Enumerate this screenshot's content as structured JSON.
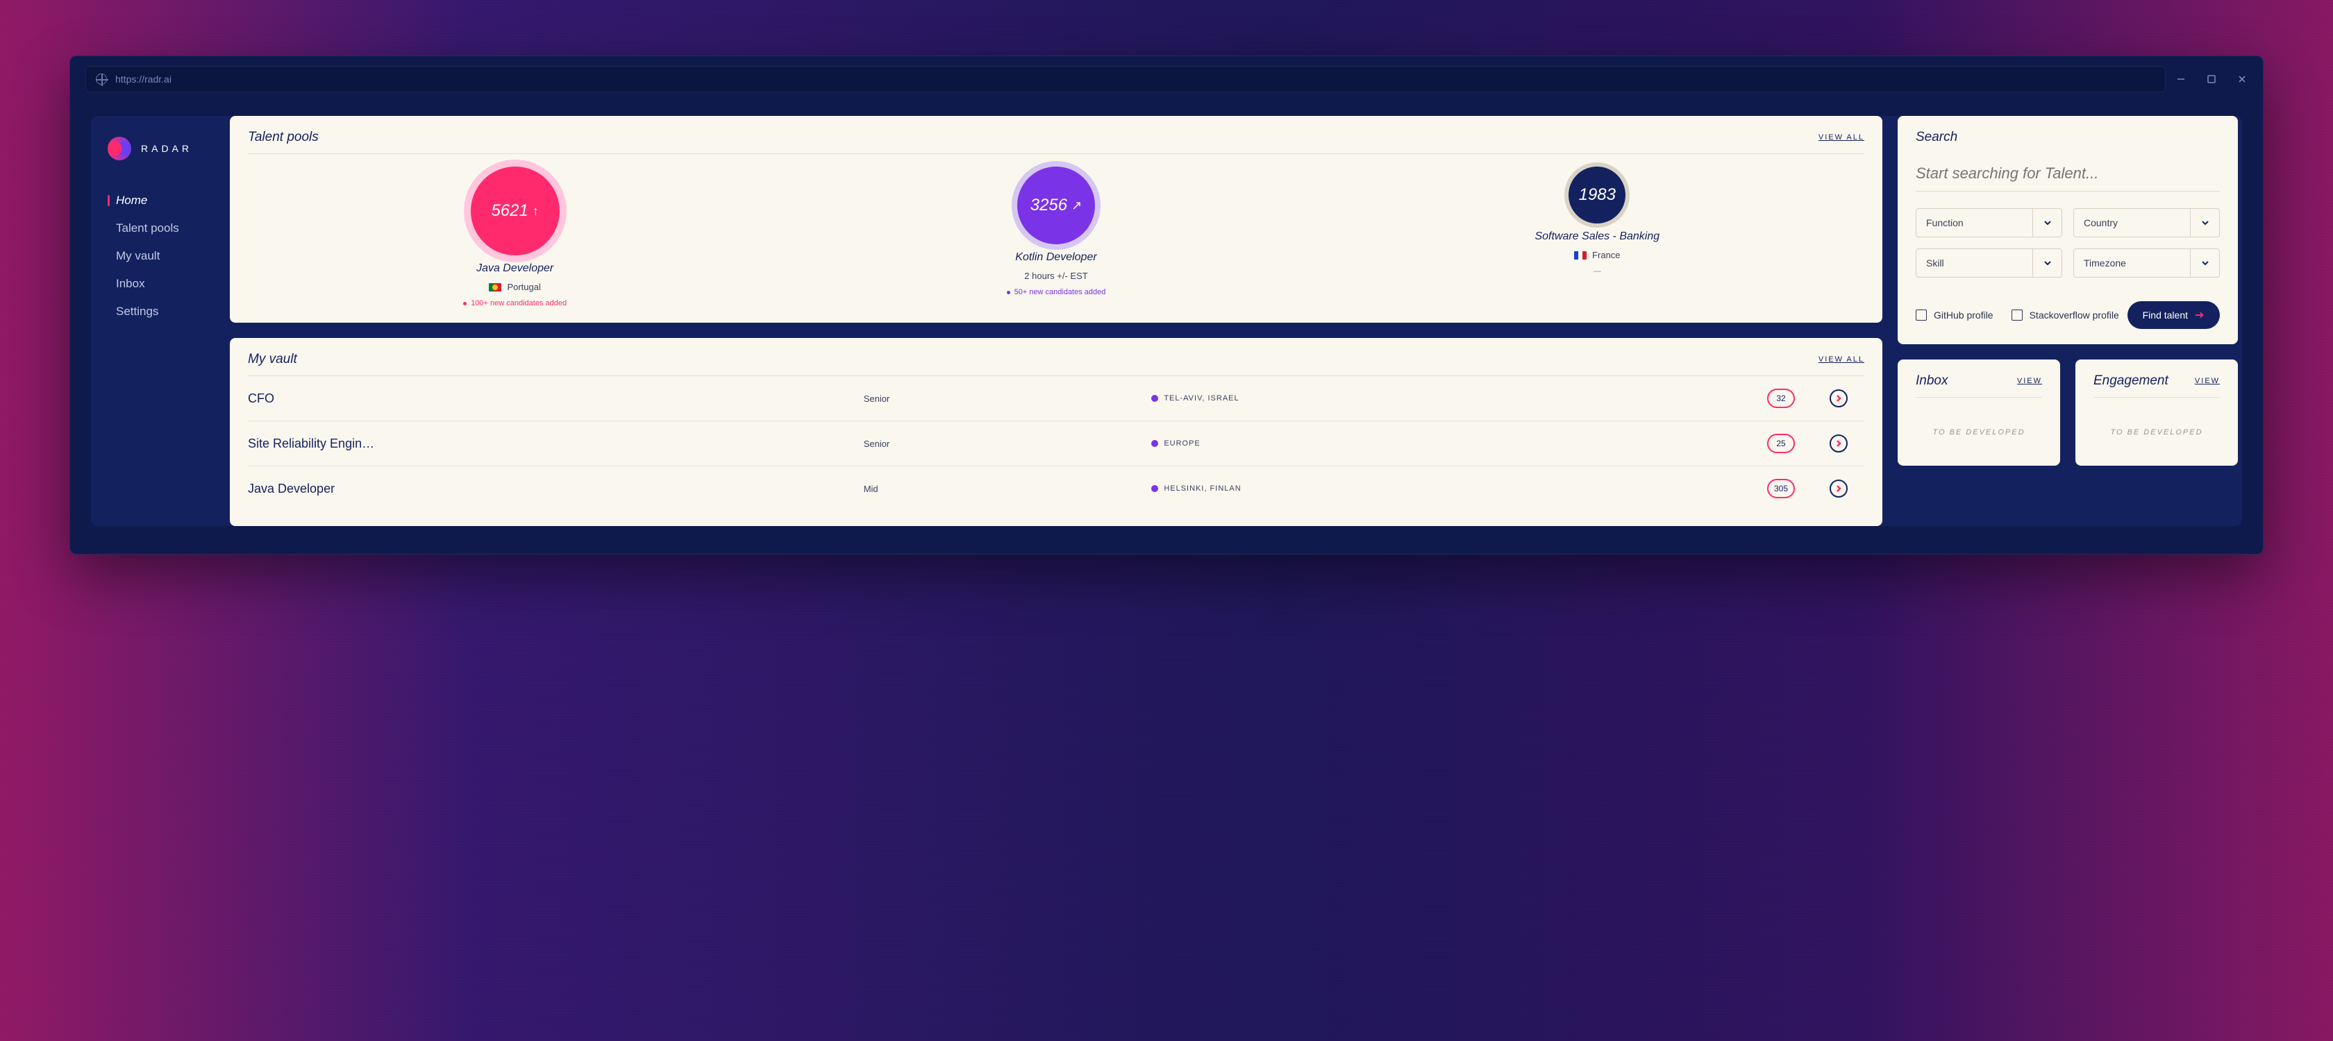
{
  "browser": {
    "url": "https://radr.ai"
  },
  "brand": {
    "name": "RADAR"
  },
  "nav": {
    "items": [
      {
        "label": "Home",
        "active": true
      },
      {
        "label": "Talent pools",
        "active": false
      },
      {
        "label": "My vault",
        "active": false
      },
      {
        "label": "Inbox",
        "active": false
      },
      {
        "label": "Settings",
        "active": false
      }
    ]
  },
  "talent_pools": {
    "title": "Talent pools",
    "view_all": "VIEW ALL",
    "pools": [
      {
        "count": "5621",
        "arrow": "↑",
        "title": "Java Developer",
        "subtitle": "Portugal",
        "flag": "pt",
        "note": "100+ new candidates added",
        "note_style": "pink"
      },
      {
        "count": "3256",
        "arrow": "↗",
        "title": "Kotlin Developer",
        "subtitle": "2 hours +/- EST",
        "flag": "",
        "note": "50+ new candidates added",
        "note_style": "purple"
      },
      {
        "count": "1983",
        "arrow": "",
        "title": "Software Sales - Banking",
        "subtitle": "France",
        "flag": "fr",
        "note": "—",
        "note_style": "dash"
      }
    ]
  },
  "vault": {
    "title": "My vault",
    "view_all": "VIEW ALL",
    "rows": [
      {
        "role": "CFO",
        "level": "Senior",
        "location": "TEL-AVIV, ISRAEL",
        "count": "32"
      },
      {
        "role": "Site Reliability Engin…",
        "level": "Senior",
        "location": "EUROPE",
        "count": "25"
      },
      {
        "role": "Java Developer",
        "level": "Mid",
        "location": "HELSINKI, FINLAN",
        "count": "305"
      }
    ]
  },
  "search": {
    "title": "Search",
    "placeholder": "Start searching for Talent...",
    "filters": [
      {
        "label": "Function"
      },
      {
        "label": "Country"
      },
      {
        "label": "Skill"
      },
      {
        "label": "Timezone"
      }
    ],
    "checks": [
      {
        "label": "GitHub profile"
      },
      {
        "label": "Stackoverflow profile"
      }
    ],
    "button": "Find talent"
  },
  "inbox": {
    "title": "Inbox",
    "view": "VIEW",
    "placeholder": "TO BE DEVELOPED"
  },
  "engagement": {
    "title": "Engagement",
    "view": "VIEW",
    "placeholder": "TO BE DEVELOPED"
  }
}
